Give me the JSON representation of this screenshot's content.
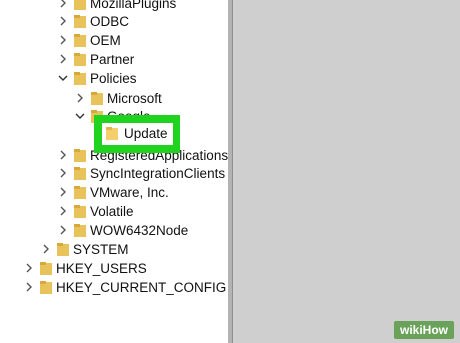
{
  "tree": {
    "rows": [
      {
        "label": "MozillaPlugins",
        "expanded": false
      },
      {
        "label": "ODBC",
        "expanded": false
      },
      {
        "label": "OEM",
        "expanded": false
      },
      {
        "label": "Partner",
        "expanded": false
      },
      {
        "label": "Policies",
        "expanded": true
      },
      {
        "label": "Microsoft",
        "expanded": false
      },
      {
        "label": "Google",
        "expanded": true
      },
      {
        "label": "RegisteredApplications",
        "expanded": false
      },
      {
        "label": "SyncIntegrationClients",
        "expanded": false
      },
      {
        "label": "VMware, Inc.",
        "expanded": false
      },
      {
        "label": "Volatile",
        "expanded": false
      },
      {
        "label": "WOW6432Node",
        "expanded": false
      },
      {
        "label": "SYSTEM",
        "expanded": false
      },
      {
        "label": "HKEY_USERS",
        "expanded": false
      },
      {
        "label": "HKEY_CURRENT_CONFIG",
        "expanded": false
      }
    ],
    "selected": {
      "label": "Update"
    }
  },
  "colors": {
    "highlight": "#1fd31f",
    "folder": "#e8c25a",
    "selected_folder": "#f4cf6b"
  },
  "watermark": {
    "text": "wikiHow"
  }
}
